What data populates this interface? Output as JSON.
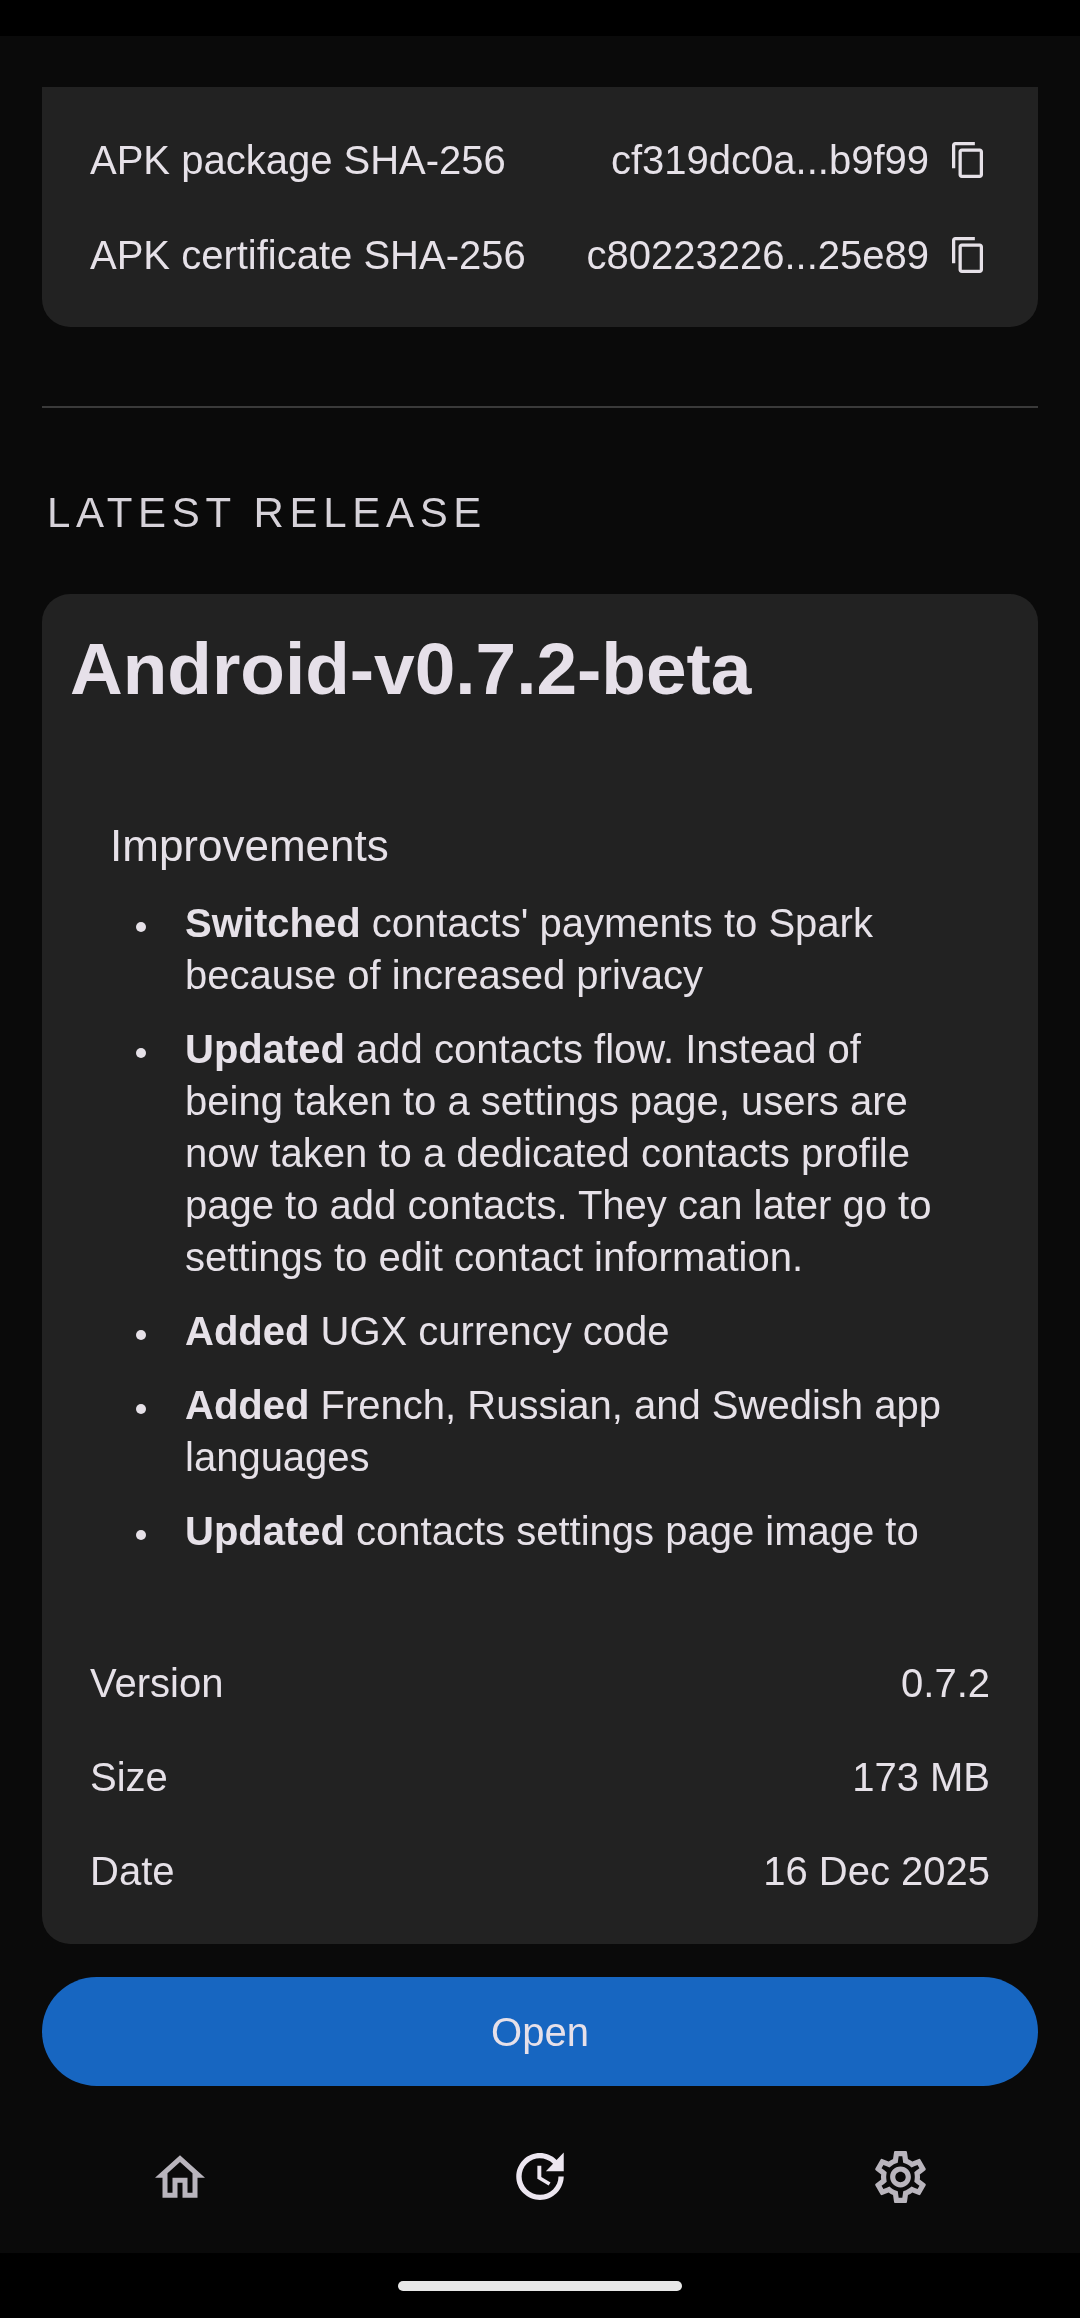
{
  "checksums": [
    {
      "label": "APK package SHA-256",
      "value": "cf319dc0a...b9f99"
    },
    {
      "label": "APK certificate SHA-256",
      "value": "c80223226...25e89"
    }
  ],
  "section_title": "LATEST RELEASE",
  "release": {
    "title": "Android-v0.7.2-beta",
    "notes": {
      "heading": "Improvements",
      "items": [
        "**Switched** contacts' payments to Spark because of increased privacy",
        "**Updated** add contacts flow. Instead of being taken to a settings page, users are now taken to a dedicated contacts profile page to add contacts. They can later go to settings to edit contact information.",
        "**Added** UGX currency code",
        "**Added** French, Russian, and Swedish app languages",
        "**Updated** contacts settings page image to"
      ]
    },
    "details": [
      {
        "label": "Version",
        "value": "0.7.2"
      },
      {
        "label": "Size",
        "value": "173 MB"
      },
      {
        "label": "Date",
        "value": "16 Dec 2025"
      }
    ]
  },
  "primary_button": {
    "label": "Open"
  },
  "bottom_nav": [
    {
      "kind": "home",
      "selected": false
    },
    {
      "kind": "history",
      "selected": true
    },
    {
      "kind": "settings",
      "selected": false
    }
  ]
}
